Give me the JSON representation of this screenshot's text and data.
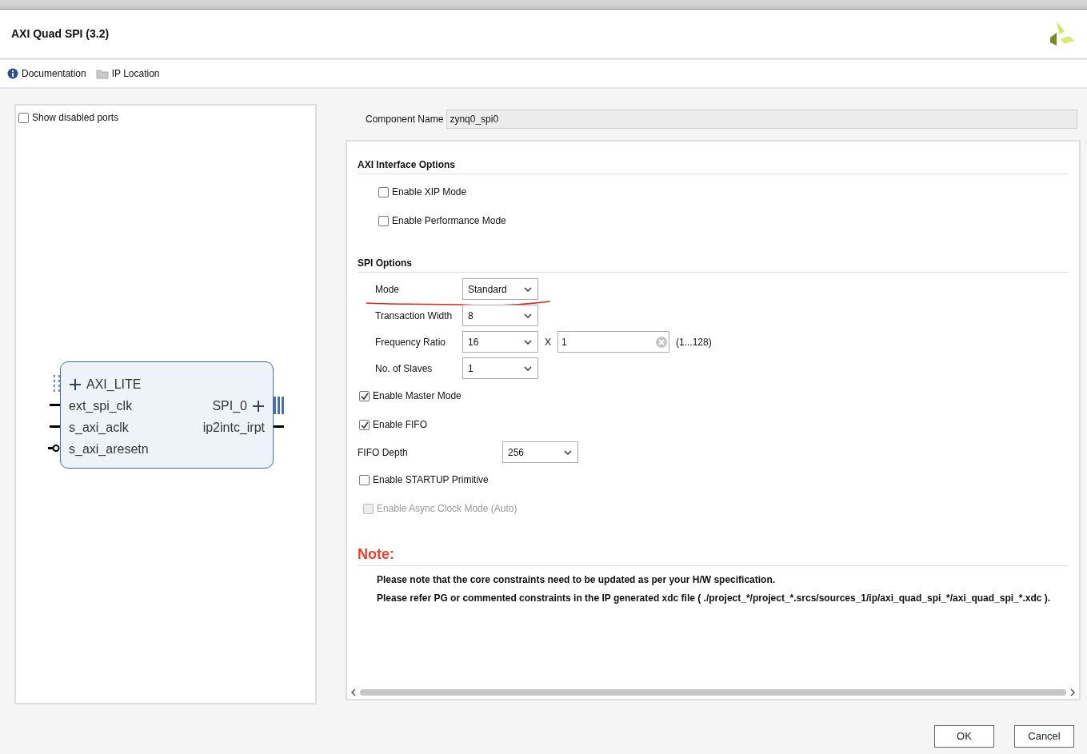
{
  "dialog": {
    "title": "AXI Quad SPI (3.2)"
  },
  "toolbar": [
    {
      "label": "Documentation",
      "kind": "info"
    },
    {
      "label": "IP Location",
      "kind": "folder"
    }
  ],
  "symbol_panel": {
    "show_disabled_ports": {
      "label": "Show disabled ports",
      "checked": false
    },
    "left_ports": [
      {
        "name": "AXI_LITE",
        "kind": "bus"
      },
      {
        "name": "ext_spi_clk",
        "kind": "wire"
      },
      {
        "name": "s_axi_aclk",
        "kind": "wire"
      },
      {
        "name": "s_axi_aresetn",
        "kind": "inverted"
      }
    ],
    "right_ports": [
      {
        "name": "SPI_0",
        "kind": "bus"
      },
      {
        "name": "ip2intc_irpt",
        "kind": "wire"
      }
    ]
  },
  "component_name": {
    "label": "Component Name",
    "value": "zynq0_spi0"
  },
  "sections": [
    {
      "title": "AXI Interface Options",
      "items": [
        {
          "kind": "checkbox",
          "label": "Enable XIP Mode",
          "checked": false,
          "disabled": false
        },
        {
          "kind": "checkbox",
          "label": "Enable Performance Mode",
          "checked": false,
          "disabled": false
        }
      ]
    },
    {
      "title": "SPI Options",
      "fields": [
        {
          "kind": "combo",
          "label": "Mode",
          "value": "Standard",
          "annotated": true
        },
        {
          "kind": "combo",
          "label": "Transaction Width",
          "value": "8",
          "annotated": false
        },
        {
          "kind": "combo_multiplier",
          "label": "Frequency Ratio",
          "value": "16",
          "multiplier": "X",
          "field_value": "1",
          "range": "(1...128)",
          "annotated": false
        },
        {
          "kind": "combo",
          "label": "No. of Slaves",
          "value": "1",
          "annotated": false
        }
      ],
      "items": [
        {
          "kind": "checkbox",
          "label": "Enable Master Mode",
          "checked": true,
          "disabled": false
        },
        {
          "kind": "checkbox",
          "label": "Enable FIFO",
          "checked": true,
          "disabled": false
        },
        {
          "kind": "combo",
          "label": "FIFO Depth",
          "value": "256"
        },
        {
          "kind": "checkbox",
          "label": "Enable STARTUP Primitive",
          "checked": false,
          "disabled": false
        },
        {
          "kind": "checkbox",
          "label": "Enable Async Clock Mode (Auto)",
          "checked": false,
          "disabled": true
        }
      ]
    }
  ],
  "note": {
    "title": "Note:",
    "lines": [
      "Please note that the core constraints need to be updated as per your H/W specification.",
      "Please refer PG or commented constraints in the IP generated xdc file ( ./project_*/project_*.srcs/sources_1/ip/axi_quad_spi_*/axi_quad_spi_*.xdc )."
    ]
  },
  "buttons": [
    "OK",
    "Cancel"
  ]
}
